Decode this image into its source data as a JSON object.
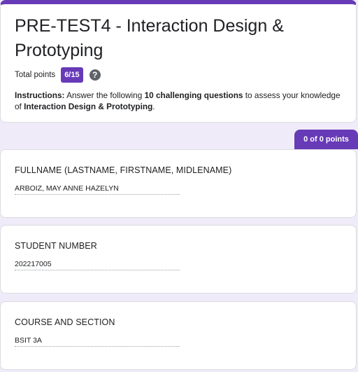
{
  "form": {
    "title": "PRE-TEST4 - Interaction Design & Prototyping",
    "total_points_label": "Total points",
    "score": "6/15",
    "instructions": {
      "lead": "Instructions:",
      "part1": " Answer the following ",
      "bold1": "10 challenging questions",
      "part2": " to assess your knowledge of ",
      "bold2": "Interaction Design & Prototyping",
      "end": "."
    }
  },
  "section": {
    "points": "0 of 0 points"
  },
  "questions": [
    {
      "title": "FULLNAME (LASTNAME, FIRSTNAME, MIDLENAME)",
      "answer": "ARBOIZ, MAY ANNE HAZELYN"
    },
    {
      "title": "STUDENT NUMBER",
      "answer": "202217005"
    },
    {
      "title": "COURSE AND SECTION",
      "answer": "BSIT 3A"
    }
  ],
  "icons": {
    "help": "help-circle-icon"
  },
  "colors": {
    "accent": "#673ab7",
    "background": "#f0ebf8"
  }
}
